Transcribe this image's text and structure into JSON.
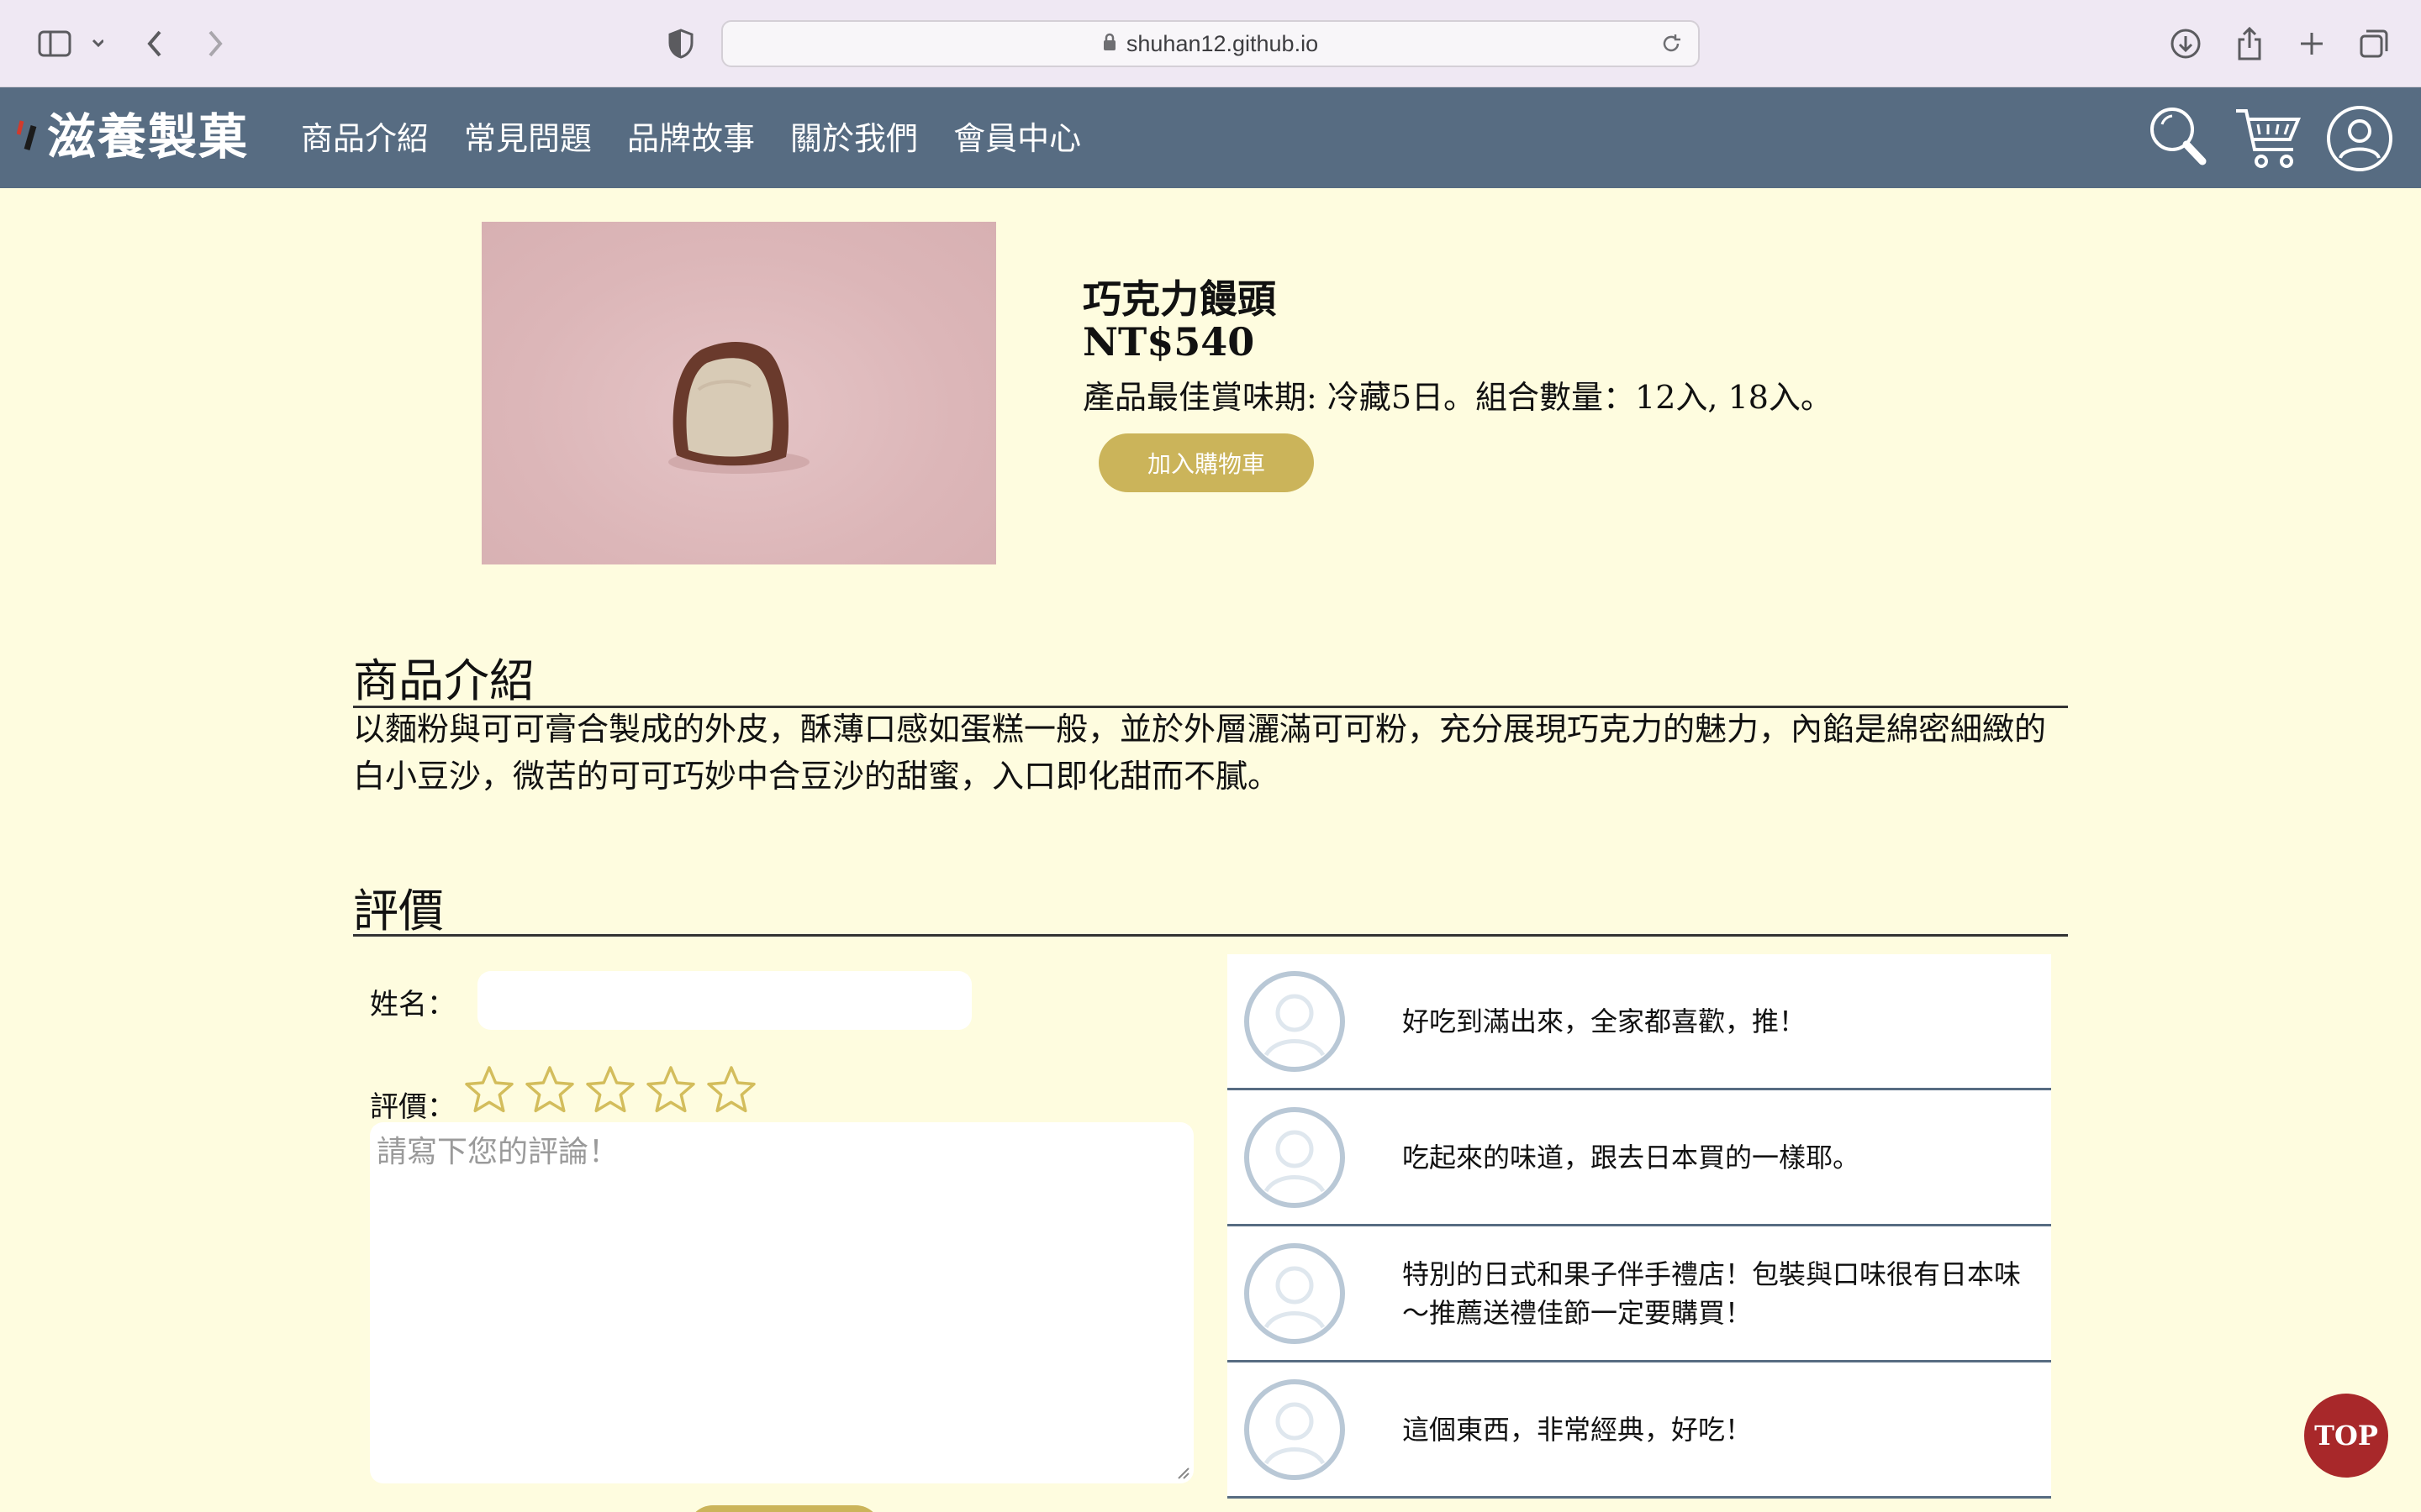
{
  "browser": {
    "url": "shuhan12.github.io"
  },
  "site": {
    "logo_text": "滋養製菓",
    "nav": [
      "商品介紹",
      "常見問題",
      "品牌故事",
      "關於我們",
      "會員中心"
    ],
    "icons": [
      "search-icon",
      "cart-icon",
      "user-icon"
    ],
    "header_color": "#576c82"
  },
  "product": {
    "name": "巧克力饅頭",
    "price": "NT$540",
    "details": "產品最佳賞味期: 冷藏5日。組合數量：12入, 18入。",
    "add_to_cart": "加入購物車"
  },
  "intro": {
    "title": "商品介紹",
    "text": "以麵粉與可可膏合製成的外皮，酥薄口感如蛋糕一般，並於外層灑滿可可粉，充分展現巧克力的魅力，內餡是綿密細緻的白小豆沙，微苦的可可巧妙中合豆沙的甜蜜，入口即化甜而不膩。"
  },
  "review_section": {
    "title": "評價",
    "name_label": "姓名：",
    "rating_label": "評價：",
    "comment_placeholder": "請寫下您的評論！",
    "rating_value": 0,
    "rating_max": 5
  },
  "reviews": [
    {
      "text": "好吃到滿出來，全家都喜歡，推！"
    },
    {
      "text": "吃起來的味道，跟去日本買的一樣耶。"
    },
    {
      "text": "特別的日式和果子伴手禮店！包裝與口味很有日本味～推薦送禮佳節一定要購買！"
    },
    {
      "text": "這個東西，非常經典，好吃！"
    }
  ],
  "top_button": "TOP",
  "colors": {
    "page_bg": "#fefcdf",
    "accent": "#cbb45a",
    "top_button": "#a8282a"
  }
}
